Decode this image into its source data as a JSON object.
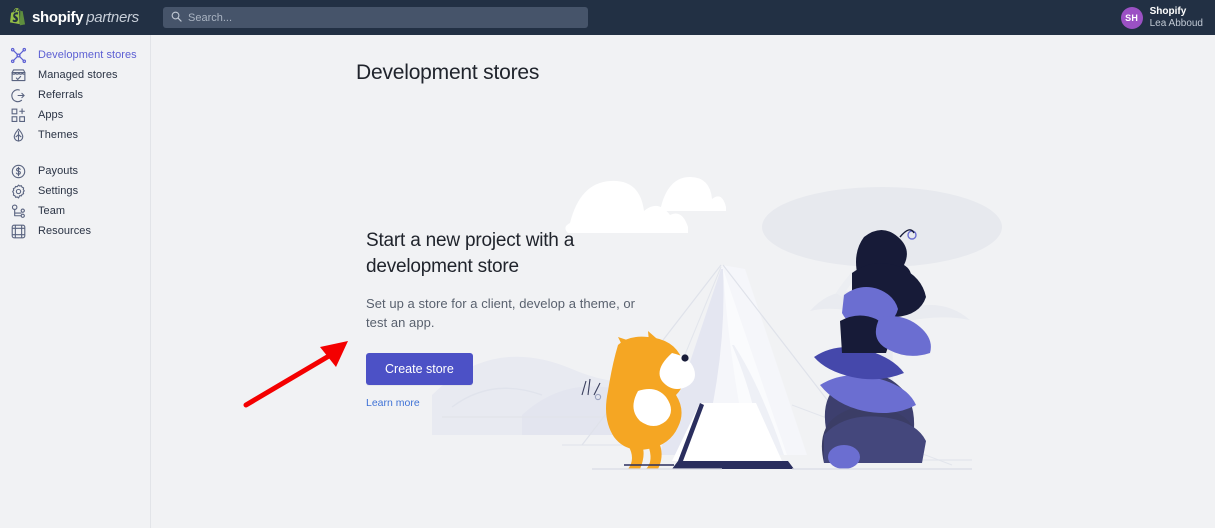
{
  "topbar": {
    "logo_primary": "shopify",
    "logo_secondary": "partners",
    "logo_icon": "shopify-bag-icon",
    "search": {
      "icon": "search-icon",
      "placeholder": "Search...",
      "value": ""
    },
    "account": {
      "avatar_initials": "SH",
      "organization": "Shopify",
      "user_name": "Lea Abboud"
    },
    "background_color": "#223044",
    "search_background_color": "#46546a",
    "avatar_color": "#9b51c4"
  },
  "sidebar": {
    "groups": [
      {
        "items": [
          {
            "label": "Development stores",
            "icon": "development-stores-icon",
            "active": true
          },
          {
            "label": "Managed stores",
            "icon": "managed-stores-icon",
            "active": false
          },
          {
            "label": "Referrals",
            "icon": "referrals-icon",
            "active": false
          },
          {
            "label": "Apps",
            "icon": "apps-icon",
            "active": false
          },
          {
            "label": "Themes",
            "icon": "themes-icon",
            "active": false
          }
        ]
      },
      {
        "items": [
          {
            "label": "Payouts",
            "icon": "payouts-icon",
            "active": false
          },
          {
            "label": "Settings",
            "icon": "settings-gear-icon",
            "active": false
          },
          {
            "label": "Team",
            "icon": "team-icon",
            "active": false
          },
          {
            "label": "Resources",
            "icon": "resources-icon",
            "active": false
          }
        ]
      }
    ],
    "active_color": "#5c5fd3",
    "label_color": "#2a3344"
  },
  "main": {
    "page_title": "Development stores",
    "hero": {
      "heading": "Start a new project with a development store",
      "description": "Set up a store for a client, develop a theme, or test an app.",
      "primary_button": "Create store",
      "secondary_link": "Learn more",
      "button_color": "#4c51c6",
      "link_color": "#3f72d6"
    },
    "illustration": {
      "name": "camping-development-store-illustration",
      "elements": [
        "clouds",
        "tree",
        "mountains",
        "tent",
        "person-with-laptop",
        "dog"
      ],
      "accent_orange": "#f5a623",
      "accent_purple": "#6f72d6",
      "accent_navy": "#171b38"
    },
    "annotation": {
      "name": "red-arrow-annotation",
      "color": "#f40000",
      "points_to": "Create store"
    },
    "background_color": "#f1f2f4"
  }
}
